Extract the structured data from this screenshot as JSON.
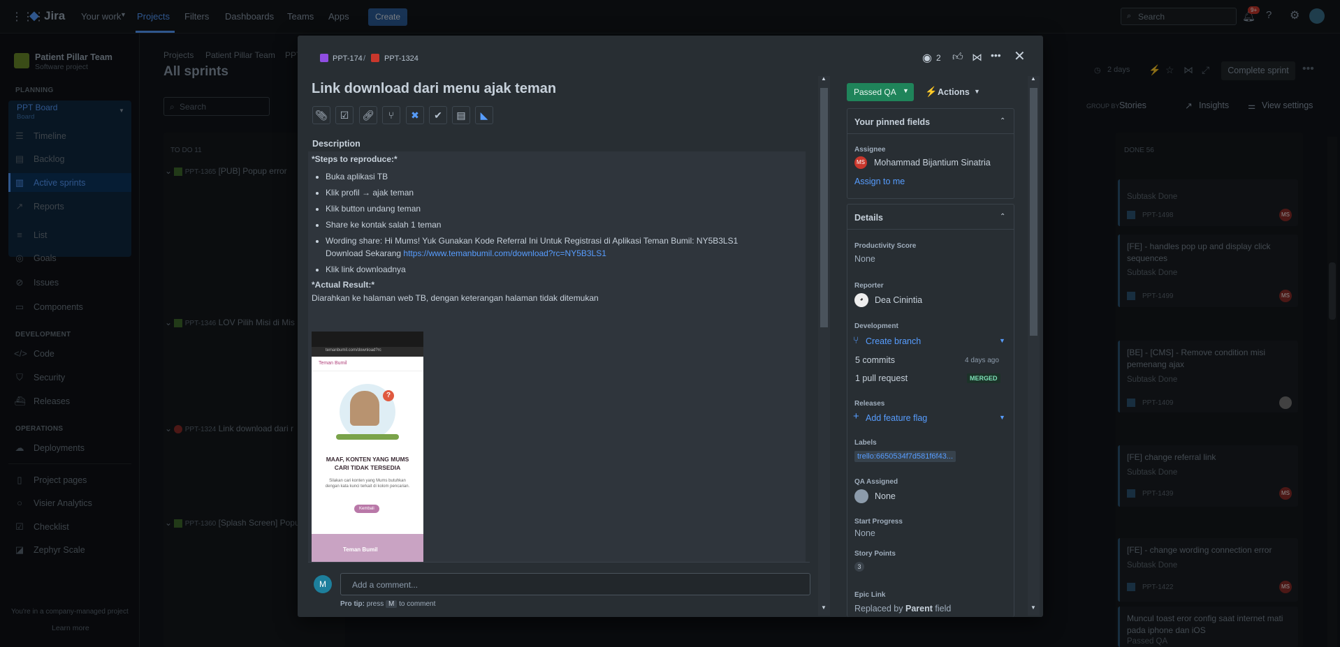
{
  "topbar": {
    "logo": "Jira",
    "nav": [
      "Your work",
      "Projects",
      "Filters",
      "Dashboards",
      "Teams",
      "Apps"
    ],
    "create": "Create",
    "search_placeholder": "Search",
    "notif_count": "9+"
  },
  "sidebar": {
    "project_name": "Patient Pillar Team",
    "project_type": "Software project",
    "planning": "PLANNING",
    "board_name": "PPT Board",
    "board_sub": "Board",
    "planning_items": [
      "Timeline",
      "Backlog",
      "Active sprints",
      "Reports"
    ],
    "other_items": [
      "List",
      "Goals",
      "Issues",
      "Components"
    ],
    "development": "DEVELOPMENT",
    "dev_items": [
      "Code",
      "Security",
      "Releases"
    ],
    "operations": "OPERATIONS",
    "ops_items": [
      "Deployments"
    ],
    "extra_items": [
      "Project pages",
      "Visier Analytics",
      "Checklist",
      "Zephyr Scale"
    ],
    "footer": "You're in a company-managed project",
    "learn_more": "Learn more"
  },
  "board": {
    "crumbs": [
      "Projects",
      "Patient Pillar Team",
      "PPT"
    ],
    "title": "All sprints",
    "search_placeholder": "Search",
    "days": "2 days",
    "complete": "Complete sprint",
    "group_by": "GROUP BY",
    "group_value": "Stories",
    "insights": "Insights",
    "view_settings": "View settings",
    "todo": "TO DO 11",
    "done": "DONE 56",
    "swimlanes": [
      {
        "key": "PPT-1365",
        "title": "[PUB] Popup error"
      },
      {
        "key": "PPT-1346",
        "title": "LOV Pilih Misi di Mis"
      },
      {
        "key": "PPT-1324",
        "title": "Link download dari r"
      },
      {
        "key": "PPT-1360",
        "title": "[Splash Screen] Popu"
      }
    ],
    "cards": [
      {
        "title": "",
        "status": "Subtask Done",
        "key": "PPT-1498",
        "av": "MS"
      },
      {
        "title": "[FE] - handles pop up and display click sequences",
        "status": "Subtask Done",
        "key": "PPT-1499",
        "av": "MS"
      },
      {
        "title": "[BE] - [CMS] - Remove condition misi pemenang ajax",
        "status": "Subtask Done",
        "key": "PPT-1409",
        "av": ""
      },
      {
        "title": "[FE] change referral link",
        "status": "Subtask Done",
        "key": "PPT-1439",
        "av": "MS"
      },
      {
        "title": "[FE] - change wording connection error",
        "status": "Subtask Done",
        "key": "PPT-1422",
        "av": "MS"
      },
      {
        "title": "Muncul toast eror config saat internet mati pada iphone dan iOS",
        "status": "Passed QA",
        "key": "",
        "av": ""
      }
    ]
  },
  "modal": {
    "parent_key": "PPT-174",
    "issue_key": "PPT-1324",
    "watchers": "2",
    "title": "Link download dari menu ajak teman",
    "desc_label": "Description",
    "steps_heading": "*Steps to reproduce:*",
    "steps": [
      "Buka aplikasi TB",
      "Klik profil → ajak teman",
      "Klik button undang teman",
      "Share ke kontak salah 1 teman"
    ],
    "wording_a": "Wording share: Hi Mums! Yuk Gunakan Kode Referral Ini Untuk Registrasi di Aplikasi Teman Bumil: NY5B3LS1",
    "wording_b": "Download Sekarang",
    "wording_link": "https://www.temanbumil.com/download?rc=NY5B3LS1",
    "last_step": "Klik link downloadnya",
    "actual_heading": "*Actual Result:*",
    "actual_text": "Diarahkan ke halaman web TB, dengan keterangan halaman tidak ditemukan",
    "shot": {
      "url": "temanbumil.com/download?rc",
      "brand": "Teman Bumil",
      "heading": "MAAF, KONTEN YANG MUMS CARI TIDAK TERSEDIA",
      "body": "Silakan cari konten yang Mums butuhkan dengan kata kunci terkait di kolom pencarian.",
      "btn": "Kembali",
      "footer_brand": "Teman Bumil"
    },
    "comment_avatar": "M",
    "comment_placeholder": "Add a comment...",
    "pro_tip": "Pro tip:",
    "pro_press": "press",
    "pro_key": "M",
    "pro_rest": "to comment",
    "status": "Passed QA",
    "actions": "Actions",
    "pinned": "Your pinned fields",
    "assignee_label": "Assignee",
    "assignee_av": "MS",
    "assignee": "Mohammad Bijantium Sinatria",
    "assign_me": "Assign to me",
    "details": "Details",
    "prod_label": "Productivity Score",
    "prod": "None",
    "reporter_label": "Reporter",
    "reporter": "Dea Cinintia",
    "dev_label": "Development",
    "create_branch": "Create branch",
    "commits": "5 commits",
    "commits_ago": "4 days ago",
    "pr": "1 pull request",
    "merged": "MERGED",
    "releases_label": "Releases",
    "add_flag": "Add feature flag",
    "labels_label": "Labels",
    "label_val": "trello:6650534f7d581f6f43...",
    "qa_label": "QA Assigned",
    "qa": "None",
    "start_label": "Start Progress",
    "start": "None",
    "sp_label": "Story Points",
    "sp": "3",
    "epic_label": "Epic Link",
    "epic_a": "Replaced by",
    "epic_b": "Parent",
    "epic_c": "field"
  }
}
